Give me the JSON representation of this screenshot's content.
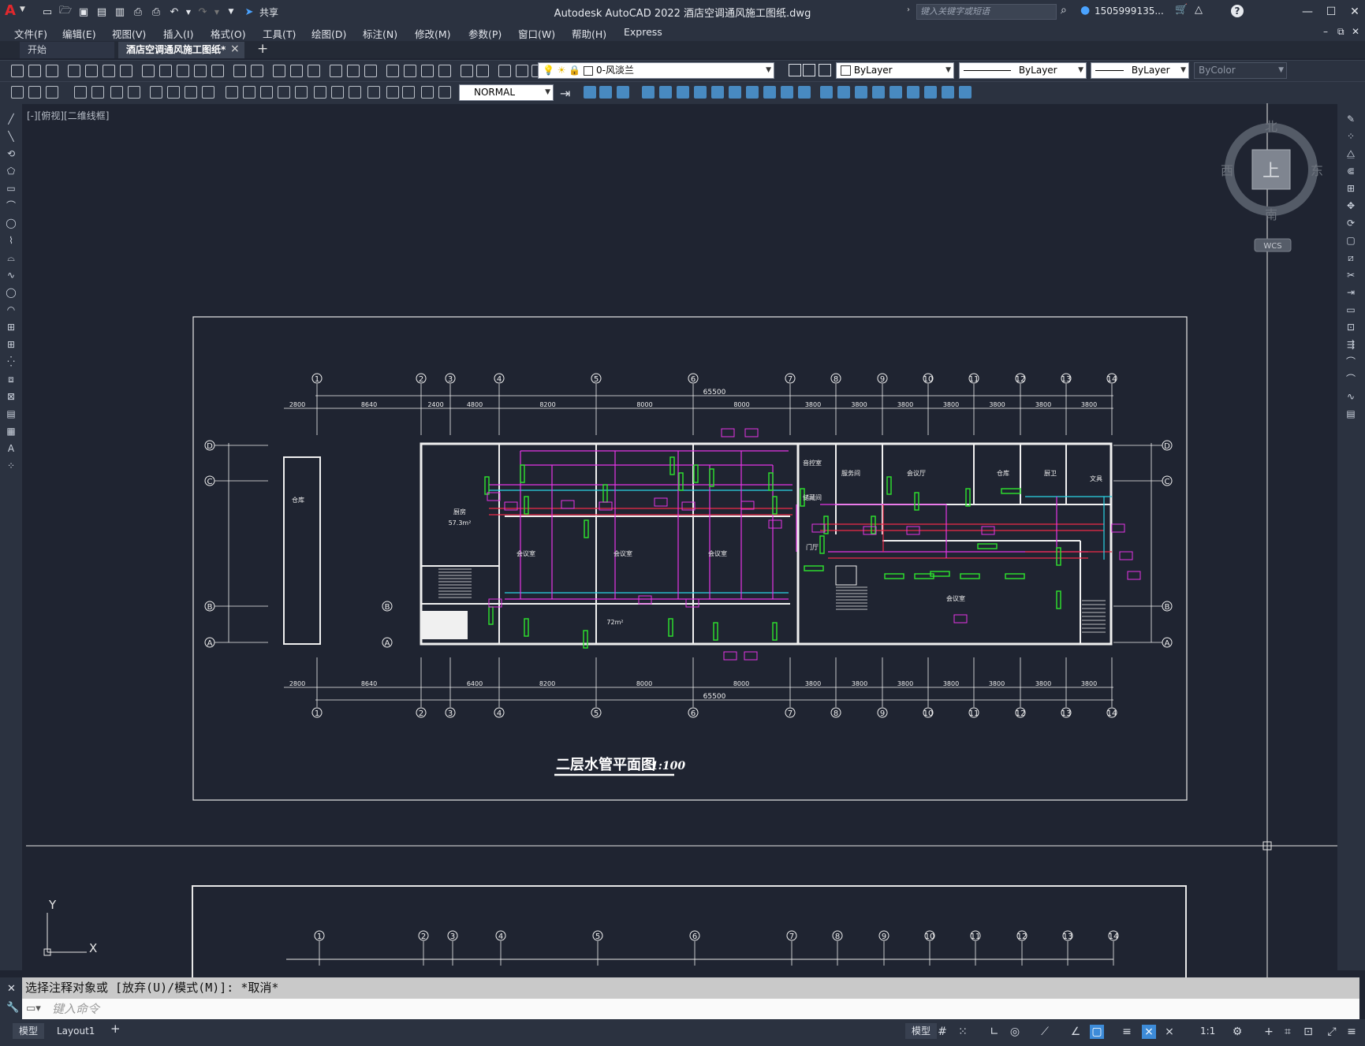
{
  "app": {
    "logo": "A",
    "title": "Autodesk AutoCAD 2022    酒店空调通风施工图纸.dwg",
    "share_label": "共享",
    "search_placeholder": "键入关键字或短语",
    "user": "1505999135...",
    "help": "?"
  },
  "menubar": {
    "items": [
      "文件(F)",
      "编辑(E)",
      "视图(V)",
      "插入(I)",
      "格式(O)",
      "工具(T)",
      "绘图(D)",
      "标注(N)",
      "修改(M)",
      "参数(P)",
      "窗口(W)",
      "帮助(H)",
      "Express"
    ]
  },
  "file_tabs": {
    "tabs": [
      {
        "label": "开始",
        "active": false
      },
      {
        "label": "酒店空调通风施工图纸*",
        "active": true
      }
    ],
    "close_glyph": "×",
    "add_glyph": "+"
  },
  "properties": {
    "layer": "0-风淡兰",
    "color": "ByLayer",
    "linetype": "ByLayer",
    "lineweight": "ByLayer",
    "plotstyle": "ByColor",
    "dimstyle": "NORMAL"
  },
  "viewport": {
    "label": "[-][俯视][二维线框]",
    "compass": {
      "north": "北",
      "south": "南",
      "east": "东",
      "west": "西",
      "top": "上"
    },
    "wcs": "WCS",
    "ucs_x": "X",
    "ucs_y": "Y"
  },
  "drawing": {
    "title_text": "二层水管平面图",
    "scale_text": "1:100",
    "grid_numbers": [
      "1",
      "2",
      "3",
      "4",
      "5",
      "6",
      "7",
      "8",
      "9",
      "10",
      "11",
      "12",
      "13",
      "14"
    ],
    "grid_letters": [
      "D",
      "C",
      "B",
      "A"
    ],
    "dims_top": [
      "2800",
      "8640",
      "2400",
      "4800",
      "8200",
      "8000",
      "8000",
      "3800",
      "3800",
      "3800",
      "3800",
      "3800",
      "3800",
      "3800"
    ],
    "dims_bottom": [
      "2800",
      "8640",
      "6400",
      "8200",
      "8000",
      "8000",
      "3800",
      "3800",
      "3800",
      "3800",
      "3800",
      "3800",
      "3800"
    ],
    "total_dim": "65500",
    "room_labels": [
      "仓库",
      "厨房",
      "57.3m²",
      "会议室",
      "会议室",
      "会议室",
      "72m²",
      "门厅",
      "会议室",
      "服务间",
      "会议厅",
      "仓库",
      "厨卫",
      "文具",
      "音控室",
      "储藏间"
    ]
  },
  "command": {
    "history": "选择注释对象或 [放弃(U)/模式(M)]: *取消*",
    "prompt_placeholder": "键入命令"
  },
  "statusbar": {
    "tabs": [
      "模型",
      "Layout1"
    ],
    "model_label": "模型",
    "scale": "1:1"
  },
  "colors": {
    "background": "#1f2431",
    "chrome": "#2b3240",
    "magenta": "#e535e5",
    "green": "#2ee62e",
    "cyan": "#2ad5e6",
    "red": "#ef2a48",
    "accent_blue": "#3d8bd8"
  }
}
